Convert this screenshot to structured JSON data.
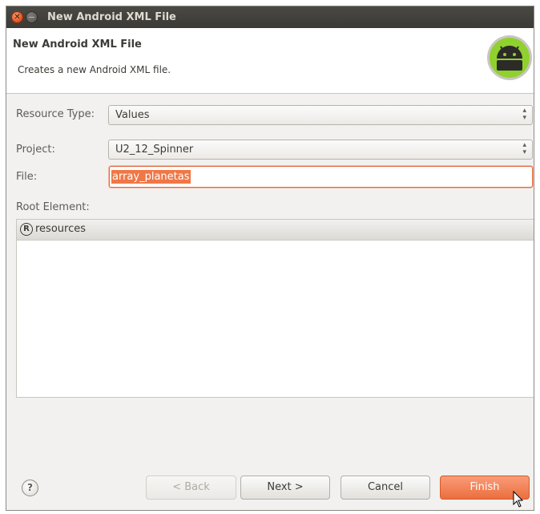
{
  "window": {
    "title": "New Android XML File",
    "close_glyph": "✕",
    "accent": "#ec6e3f"
  },
  "banner": {
    "heading": "New Android XML File",
    "subtitle": "Creates a new Android XML file.",
    "logo_icon": "android-icon"
  },
  "form": {
    "resource_type_label": "Resource Type:",
    "resource_type_value": "Values",
    "project_label": "Project:",
    "project_value": "U2_12_Spinner",
    "file_label": "File:",
    "file_value": "array_planetas",
    "root_element_label": "Root Element:"
  },
  "tree": {
    "items": [
      {
        "icon": "R",
        "label": "resources"
      }
    ]
  },
  "buttons": {
    "help": "?",
    "back": "< Back",
    "next": "Next >",
    "cancel": "Cancel",
    "finish": "Finish"
  }
}
